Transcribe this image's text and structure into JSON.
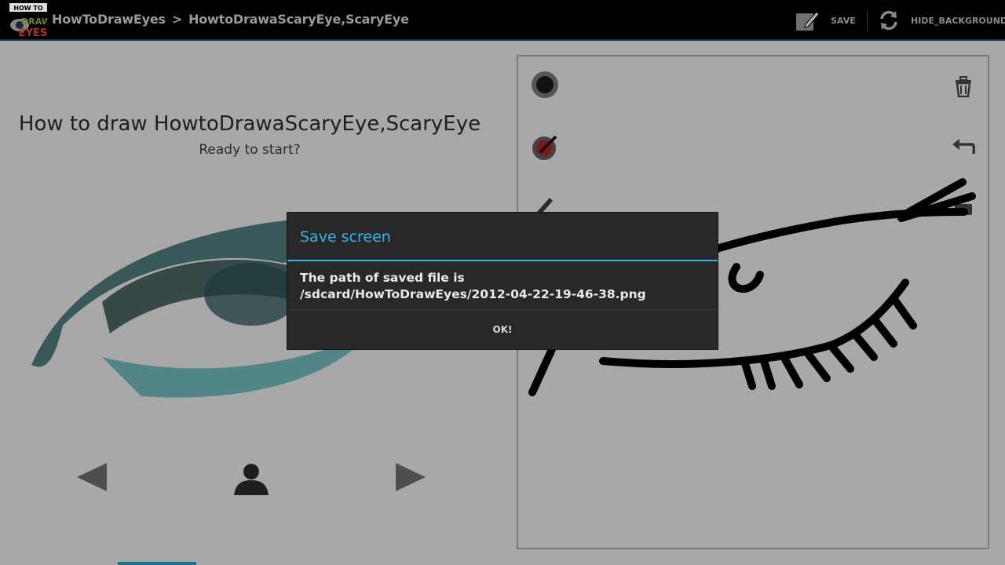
{
  "actionbar": {
    "logo_text": [
      "HOW TO",
      "DRAW",
      "EYES"
    ],
    "breadcrumb": {
      "app": "HowToDrawEyes",
      "separator": ">",
      "page": "HowtoDrawaScaryEye,ScaryEye"
    },
    "save_label": "SAVE",
    "save_icon": "edit-save-icon",
    "hide_background_label": "HIDE_BACKGROUND",
    "hide_background_icon": "refresh-icon"
  },
  "tutorial": {
    "title": "How to draw HowtoDrawaScaryEye,ScaryEye",
    "subtitle": "Ready to start?",
    "prev_icon": "left-arrow-icon",
    "person_icon": "person-icon",
    "next_icon": "right-arrow-icon"
  },
  "canvas_tools": {
    "left": [
      "brush-size-icon",
      "color-picker-icon",
      "pencil-icon"
    ],
    "right": [
      "trash-icon",
      "undo-icon",
      "eraser-icon"
    ]
  },
  "dialog": {
    "title": "Save screen",
    "message_line1": "The path of saved file is",
    "message_line2": "/sdcard/HowToDrawEyes/2012-04-22-19-46-38.png",
    "ok_label": "OK!"
  },
  "colors": {
    "accent": "#33b5e5",
    "actionbar_bg": "#000000",
    "dialog_bg": "#282828",
    "dimmed_background": "#a8a8a8"
  }
}
